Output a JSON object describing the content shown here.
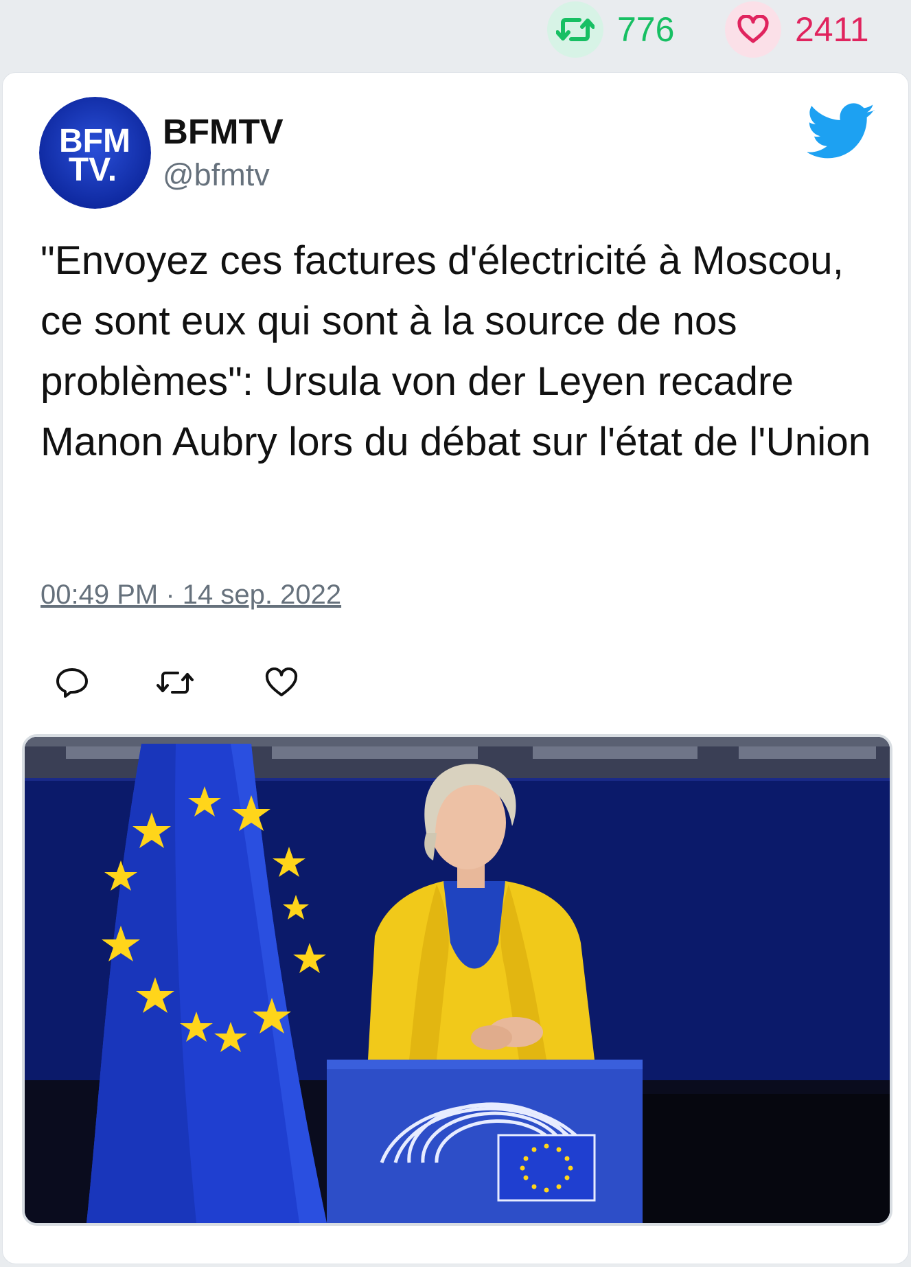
{
  "stats": {
    "retweets": "776",
    "likes": "2411",
    "retweet_icon": "retweet-icon",
    "like_icon": "heart-icon",
    "retweet_color": "#17bf63",
    "like_color": "#e0245e"
  },
  "tweet": {
    "author": {
      "name": "BFMTV",
      "handle": "@bfmtv",
      "avatar_logo_lines": [
        "BFM",
        "TV."
      ]
    },
    "text": "\"Envoyez ces factures d'électricité à Moscou, ce sont eux qui sont à la source de nos problèmes\": Ursula von der Leyen recadre Manon Aubry lors du débat sur l'état de l'Union",
    "timestamp": "00:49 PM · 14 sep. 2022",
    "actions": [
      "reply-icon",
      "retweet-icon",
      "like-icon"
    ],
    "brand_icon": "twitter-bird-icon",
    "brand_color": "#1da1f2",
    "media": {
      "kind": "video-still",
      "subject": "speaker-at-podium-with-eu-flag"
    }
  }
}
